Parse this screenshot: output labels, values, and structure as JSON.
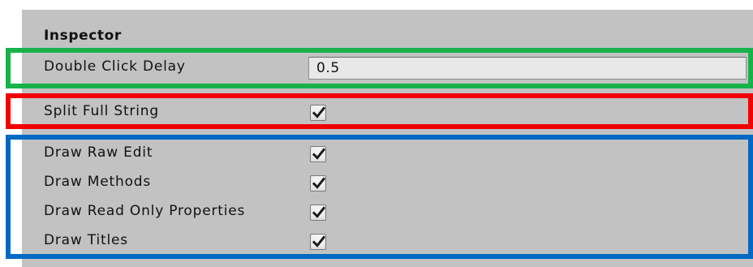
{
  "inspector": {
    "title": "Inspector",
    "double_click_delay": {
      "label": "Double Click Delay",
      "value": "0.5"
    },
    "split_full_string": {
      "label": "Split Full String",
      "checked": true
    },
    "draw_options": [
      {
        "label": "Draw Raw Edit",
        "checked": true
      },
      {
        "label": "Draw Methods",
        "checked": true
      },
      {
        "label": "Draw Read Only Properties",
        "checked": true
      },
      {
        "label": "Draw Titles",
        "checked": true
      }
    ]
  },
  "icons": {
    "checkbox": "checkmark-icon"
  },
  "colors": {
    "panel_background": "#c2c2c2",
    "highlight_green": "#17b24a",
    "highlight_red": "#f20000",
    "highlight_blue": "#0069c4"
  }
}
